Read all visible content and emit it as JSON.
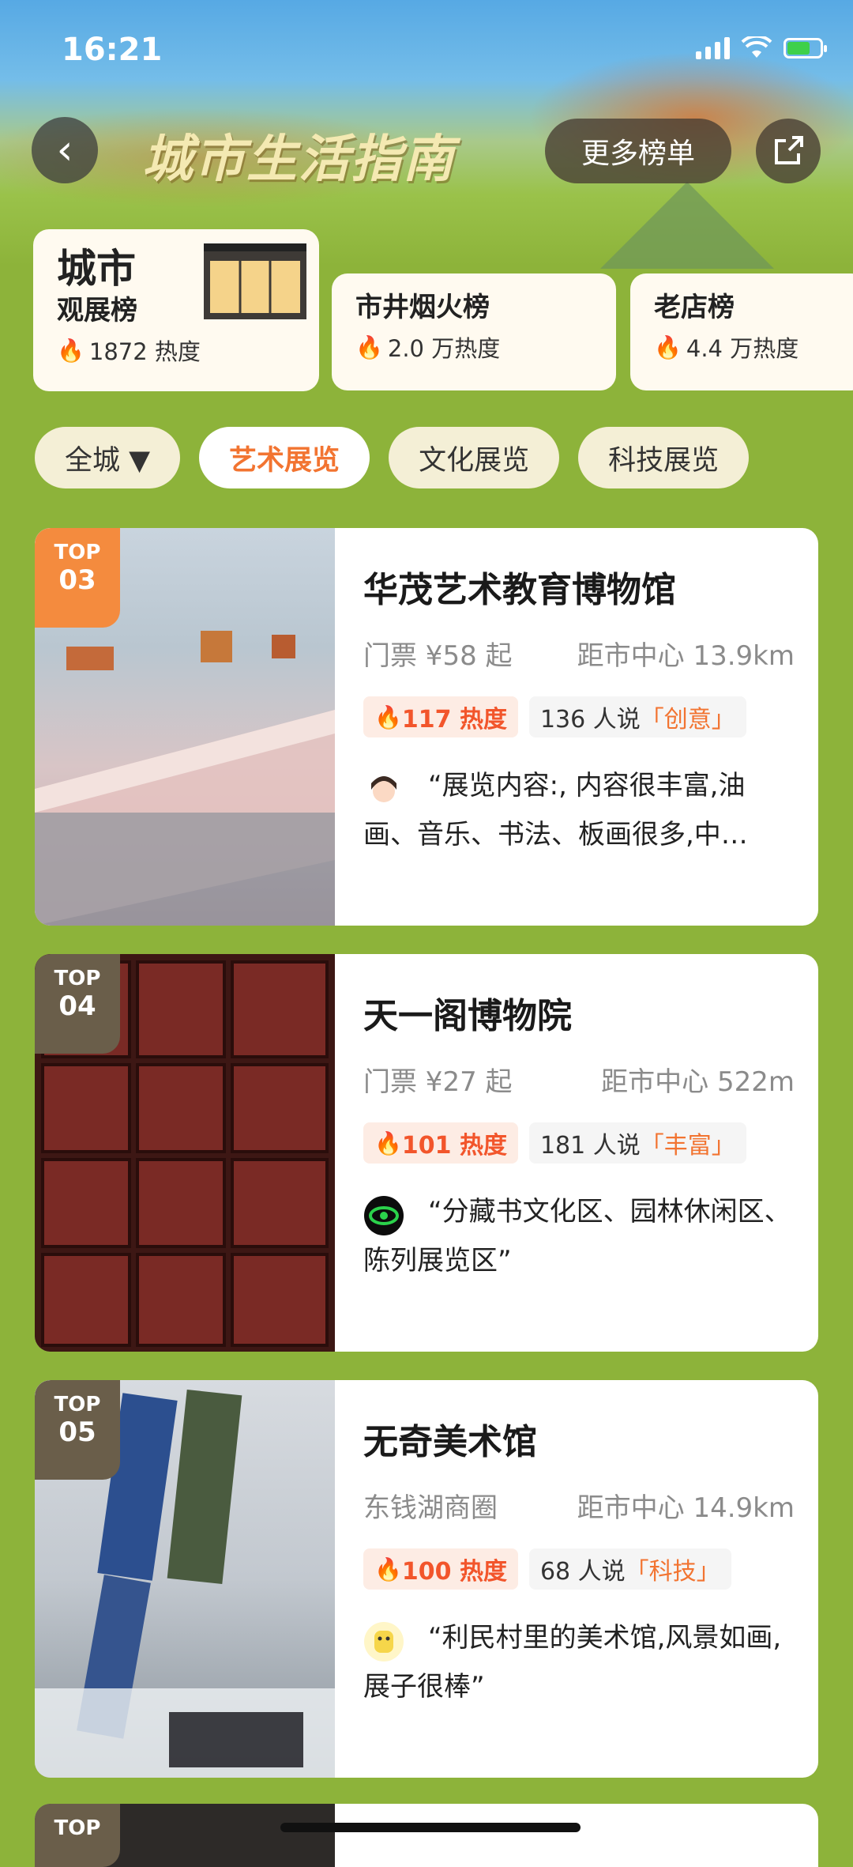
{
  "status_bar": {
    "time": "16:21"
  },
  "header": {
    "title": "城市生活指南",
    "more_label": "更多榜单"
  },
  "rank_cards": [
    {
      "name_line1": "城市",
      "name_line2": "观展榜",
      "heat": "1872 热度"
    },
    {
      "name_line1": "市井烟火榜",
      "heat": "2.0 万热度"
    },
    {
      "name_line1": "老店榜",
      "heat": "4.4 万热度"
    }
  ],
  "filters": [
    {
      "label": "全城 ▼"
    },
    {
      "label": "艺术展览",
      "active": true
    },
    {
      "label": "文化展览"
    },
    {
      "label": "科技展览"
    }
  ],
  "venues": [
    {
      "top_label": "TOP",
      "rank": "03",
      "name": "华茂艺术教育博物馆",
      "price": "门票 ¥58 起",
      "distance": "距市中心 13.9km",
      "heat": "117 热度",
      "say_count": "136 人说",
      "say_tag": "「创意」",
      "review": "“展览内容:, 内容很丰富,油画、音乐、书法、板画很多,中…"
    },
    {
      "top_label": "TOP",
      "rank": "04",
      "name": "天一阁博物院",
      "price": "门票 ¥27 起",
      "distance": "距市中心 522m",
      "heat": "101 热度",
      "say_count": "181 人说",
      "say_tag": "「丰富」",
      "review": "“分藏书文化区、园林休闲区、陈列展览区”"
    },
    {
      "top_label": "TOP",
      "rank": "05",
      "name": "无奇美术馆",
      "price": "东钱湖商圈",
      "distance": "距市中心 14.9km",
      "heat": "100 热度",
      "say_count": "68 人说",
      "say_tag": "「科技」",
      "review": "“利民村里的美术馆,风景如画,展子很棒”"
    }
  ],
  "partial_card": {
    "top_label": "TOP"
  },
  "colors": {
    "accent": "#f27431",
    "heat": "#f2552b",
    "page_bg": "#8db33a"
  },
  "icons": [
    "back-icon",
    "share-icon",
    "flame-icon",
    "wifi-icon",
    "battery-icon",
    "signal-icon"
  ]
}
